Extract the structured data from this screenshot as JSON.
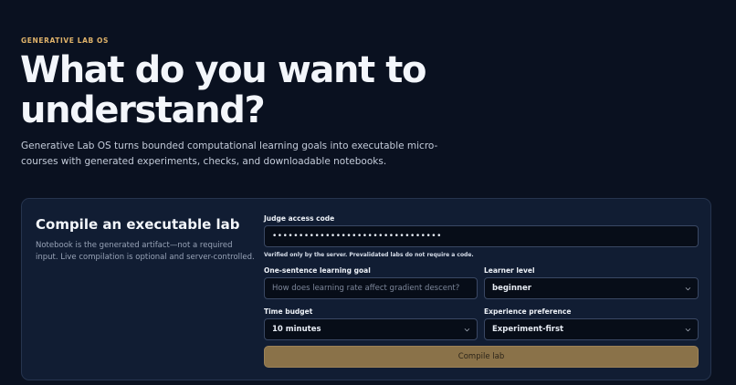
{
  "hero": {
    "eyebrow": "GENERATIVE LAB OS",
    "title": "What do you want to understand?",
    "subtitle": "Generative Lab OS turns bounded computational learning goals into executable micro-courses with generated experiments, checks, and downloadable notebooks."
  },
  "form": {
    "title": "Compile an executable lab",
    "description": "Notebook is the generated artifact—not a required input. Live compilation is optional and server-controlled.",
    "access_code": {
      "label": "Judge access code",
      "value": "••••••••••••••••••••••••••••••••",
      "hint": "Verified only by the server. Prevalidated labs do not require a code."
    },
    "goal": {
      "label": "One-sentence learning goal",
      "placeholder": "How does learning rate affect gradient descent?"
    },
    "level": {
      "label": "Learner level",
      "selected": "beginner"
    },
    "time_budget": {
      "label": "Time budget",
      "selected": "10 minutes"
    },
    "experience": {
      "label": "Experience preference",
      "selected": "Experiment-first"
    },
    "submit_label": "Compile lab"
  },
  "icons": {
    "select_arrow": "chevron-down-icon"
  },
  "colors": {
    "background": "#0a1120",
    "card": "#111d33",
    "accent": "#e0b36a",
    "button": "#8a7249"
  }
}
